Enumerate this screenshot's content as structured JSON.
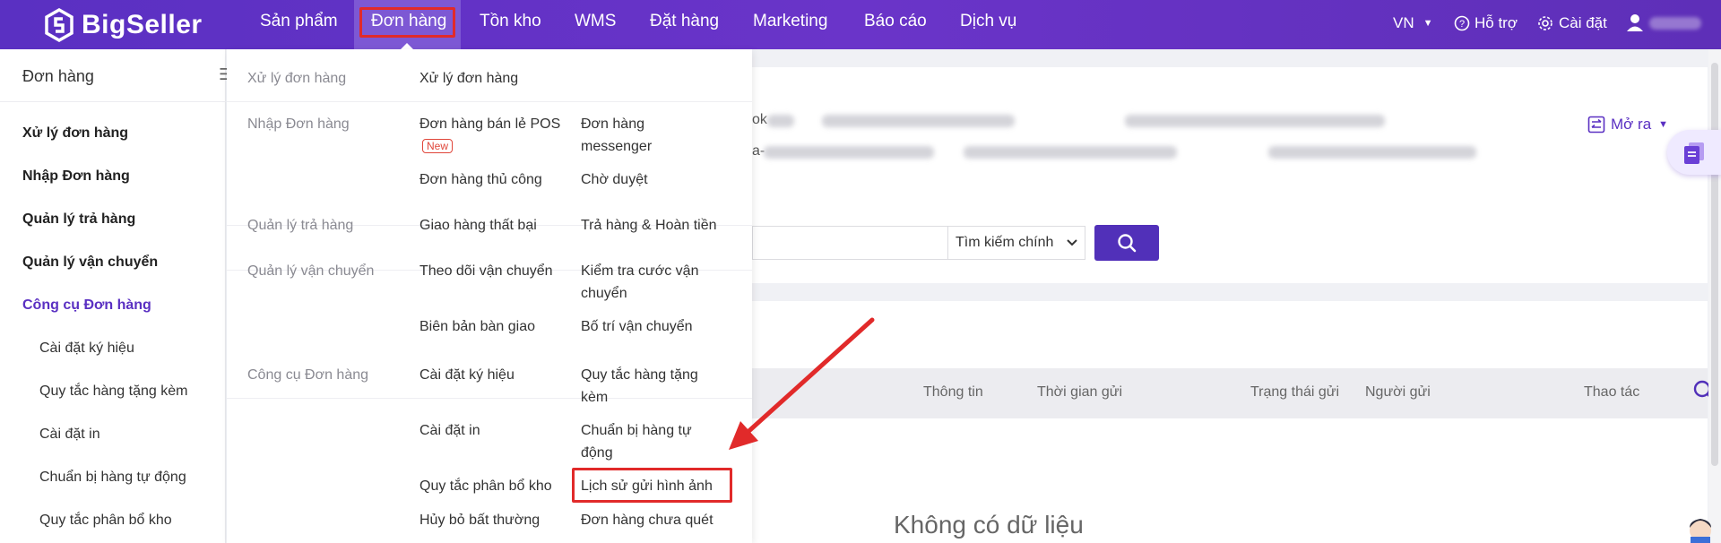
{
  "app": {
    "logo_text": "BigSeller"
  },
  "nav": {
    "items": [
      "Sản phẩm",
      "Đơn hàng",
      "Tồn kho",
      "WMS",
      "Đặt hàng",
      "Marketing",
      "Báo cáo",
      "Dịch vụ"
    ],
    "active": "Đơn hàng"
  },
  "top_right": {
    "language": "VN",
    "help": "Hỗ trợ",
    "settings": "Cài đặt"
  },
  "sidebar": {
    "title": "Đơn hàng",
    "items": [
      "Xử lý đơn hàng",
      "Nhập Đơn hàng",
      "Quản lý trả hàng",
      "Quản lý vận chuyển",
      "Công cụ Đơn hàng"
    ],
    "active": "Công cụ Đơn hàng",
    "subitems": [
      "Cài đặt ký hiệu",
      "Quy tắc hàng tặng kèm",
      "Cài đặt in",
      "Chuẩn bị hàng tự động",
      "Quy tắc phân bổ kho"
    ]
  },
  "dropdown": {
    "groups": [
      {
        "name": "Xử lý đơn hàng",
        "items": [
          "Xử lý đơn hàng"
        ]
      },
      {
        "name": "Nhập Đơn hàng",
        "items": [
          "Đơn hàng bán lẻ POS",
          "Đơn hàng messenger",
          "Đơn hàng thủ công",
          "Chờ duyệt"
        ],
        "badge": "New"
      },
      {
        "name": "Quản lý trả hàng",
        "items": [
          "Giao hàng thất bại",
          "Trả hàng & Hoàn tiền"
        ]
      },
      {
        "name": "Quản lý vận chuyển",
        "items": [
          "Theo dõi vận chuyển",
          "Kiểm tra cước vận chuyển",
          "Biên bản bàn giao",
          "Bố trí vận chuyển"
        ]
      },
      {
        "name": "Công cụ Đơn hàng",
        "items": [
          "Cài đặt ký hiệu",
          "Quy tắc hàng tặng kèm",
          "Cài đặt in",
          "Chuẩn bị hàng tự động",
          "Quy tắc phân bổ kho",
          "Lịch sử gửi hình ảnh",
          "Hủy bỏ bất thường",
          "Đơn hàng chưa quét"
        ]
      }
    ],
    "highlighted": "Lịch sử gửi hình ảnh"
  },
  "main": {
    "shop_fragments": [
      "ok",
      "a-"
    ],
    "expand_label": "Mở ra",
    "search": {
      "select_value": "Tìm kiếm chính"
    },
    "table_headers": [
      "Thông tin",
      "Thời gian gửi",
      "Trạng thái gửi",
      "Người gửi",
      "Thao tác"
    ],
    "empty_text": "Không có dữ liệu"
  },
  "colors": {
    "brand": "#5a30c2",
    "highlight": "#e12a2a",
    "button": "#5130b9"
  }
}
